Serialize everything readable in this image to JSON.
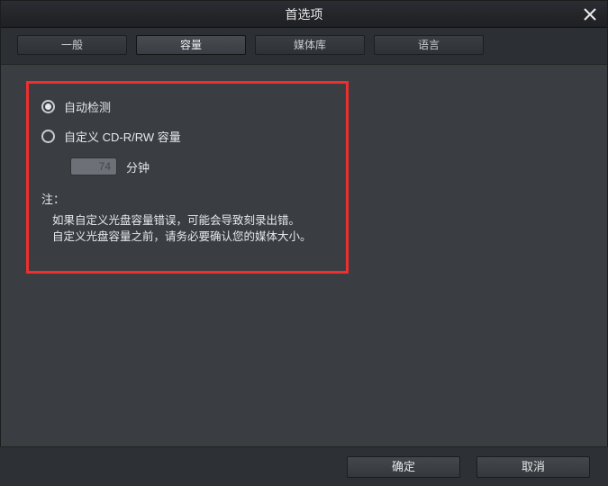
{
  "window": {
    "title": "首选项"
  },
  "tabs": {
    "general": "一般",
    "capacity": "容量",
    "library": "媒体库",
    "language": "语言",
    "active": "capacity"
  },
  "capacity": {
    "auto_detect": {
      "label": "自动检测",
      "selected": true
    },
    "custom": {
      "label": "自定义 CD-R/RW 容量",
      "selected": false
    },
    "minutes_value": "74",
    "minutes_unit": "分钟",
    "note_title": "注：",
    "note_line1": "如果自定义光盘容量错误，可能会导致刻录出错。",
    "note_line2": "自定义光盘容量之前，请务必要确认您的媒体大小。"
  },
  "buttons": {
    "ok": "确定",
    "cancel": "取消"
  }
}
